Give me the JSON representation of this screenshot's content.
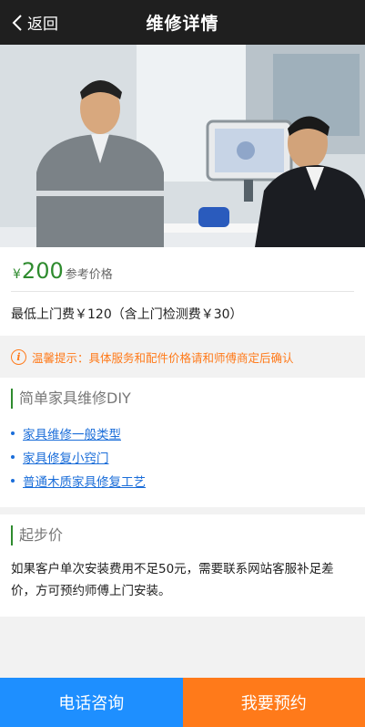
{
  "header": {
    "back_label": "返回",
    "title": "维修详情"
  },
  "price": {
    "currency": "¥",
    "amount": "200",
    "label": "参考价格",
    "min_fee": "最低上门费￥120（含上门检测费￥30）"
  },
  "tip": {
    "icon": "info-icon",
    "icon_glyph": "i",
    "text": "温馨提示：具体服务和配件价格请和师傅商定后确认"
  },
  "diy": {
    "title": "简单家具维修DIY",
    "links": [
      "家具维修一般类型",
      "家具修复小窍门",
      "普通木质家具修复工艺"
    ]
  },
  "starting": {
    "title": "起步价",
    "text": "如果客户单次安装费用不足50元，需要联系网站客服补足差价，方可预约师傅上门安装。"
  },
  "actions": {
    "call": "电话咨询",
    "book": "我要预约"
  },
  "colors": {
    "accent_green": "#2e8b2e",
    "accent_orange": "#ff7a1a",
    "accent_blue": "#1e8fff",
    "header_bg": "#1f1f1f"
  }
}
